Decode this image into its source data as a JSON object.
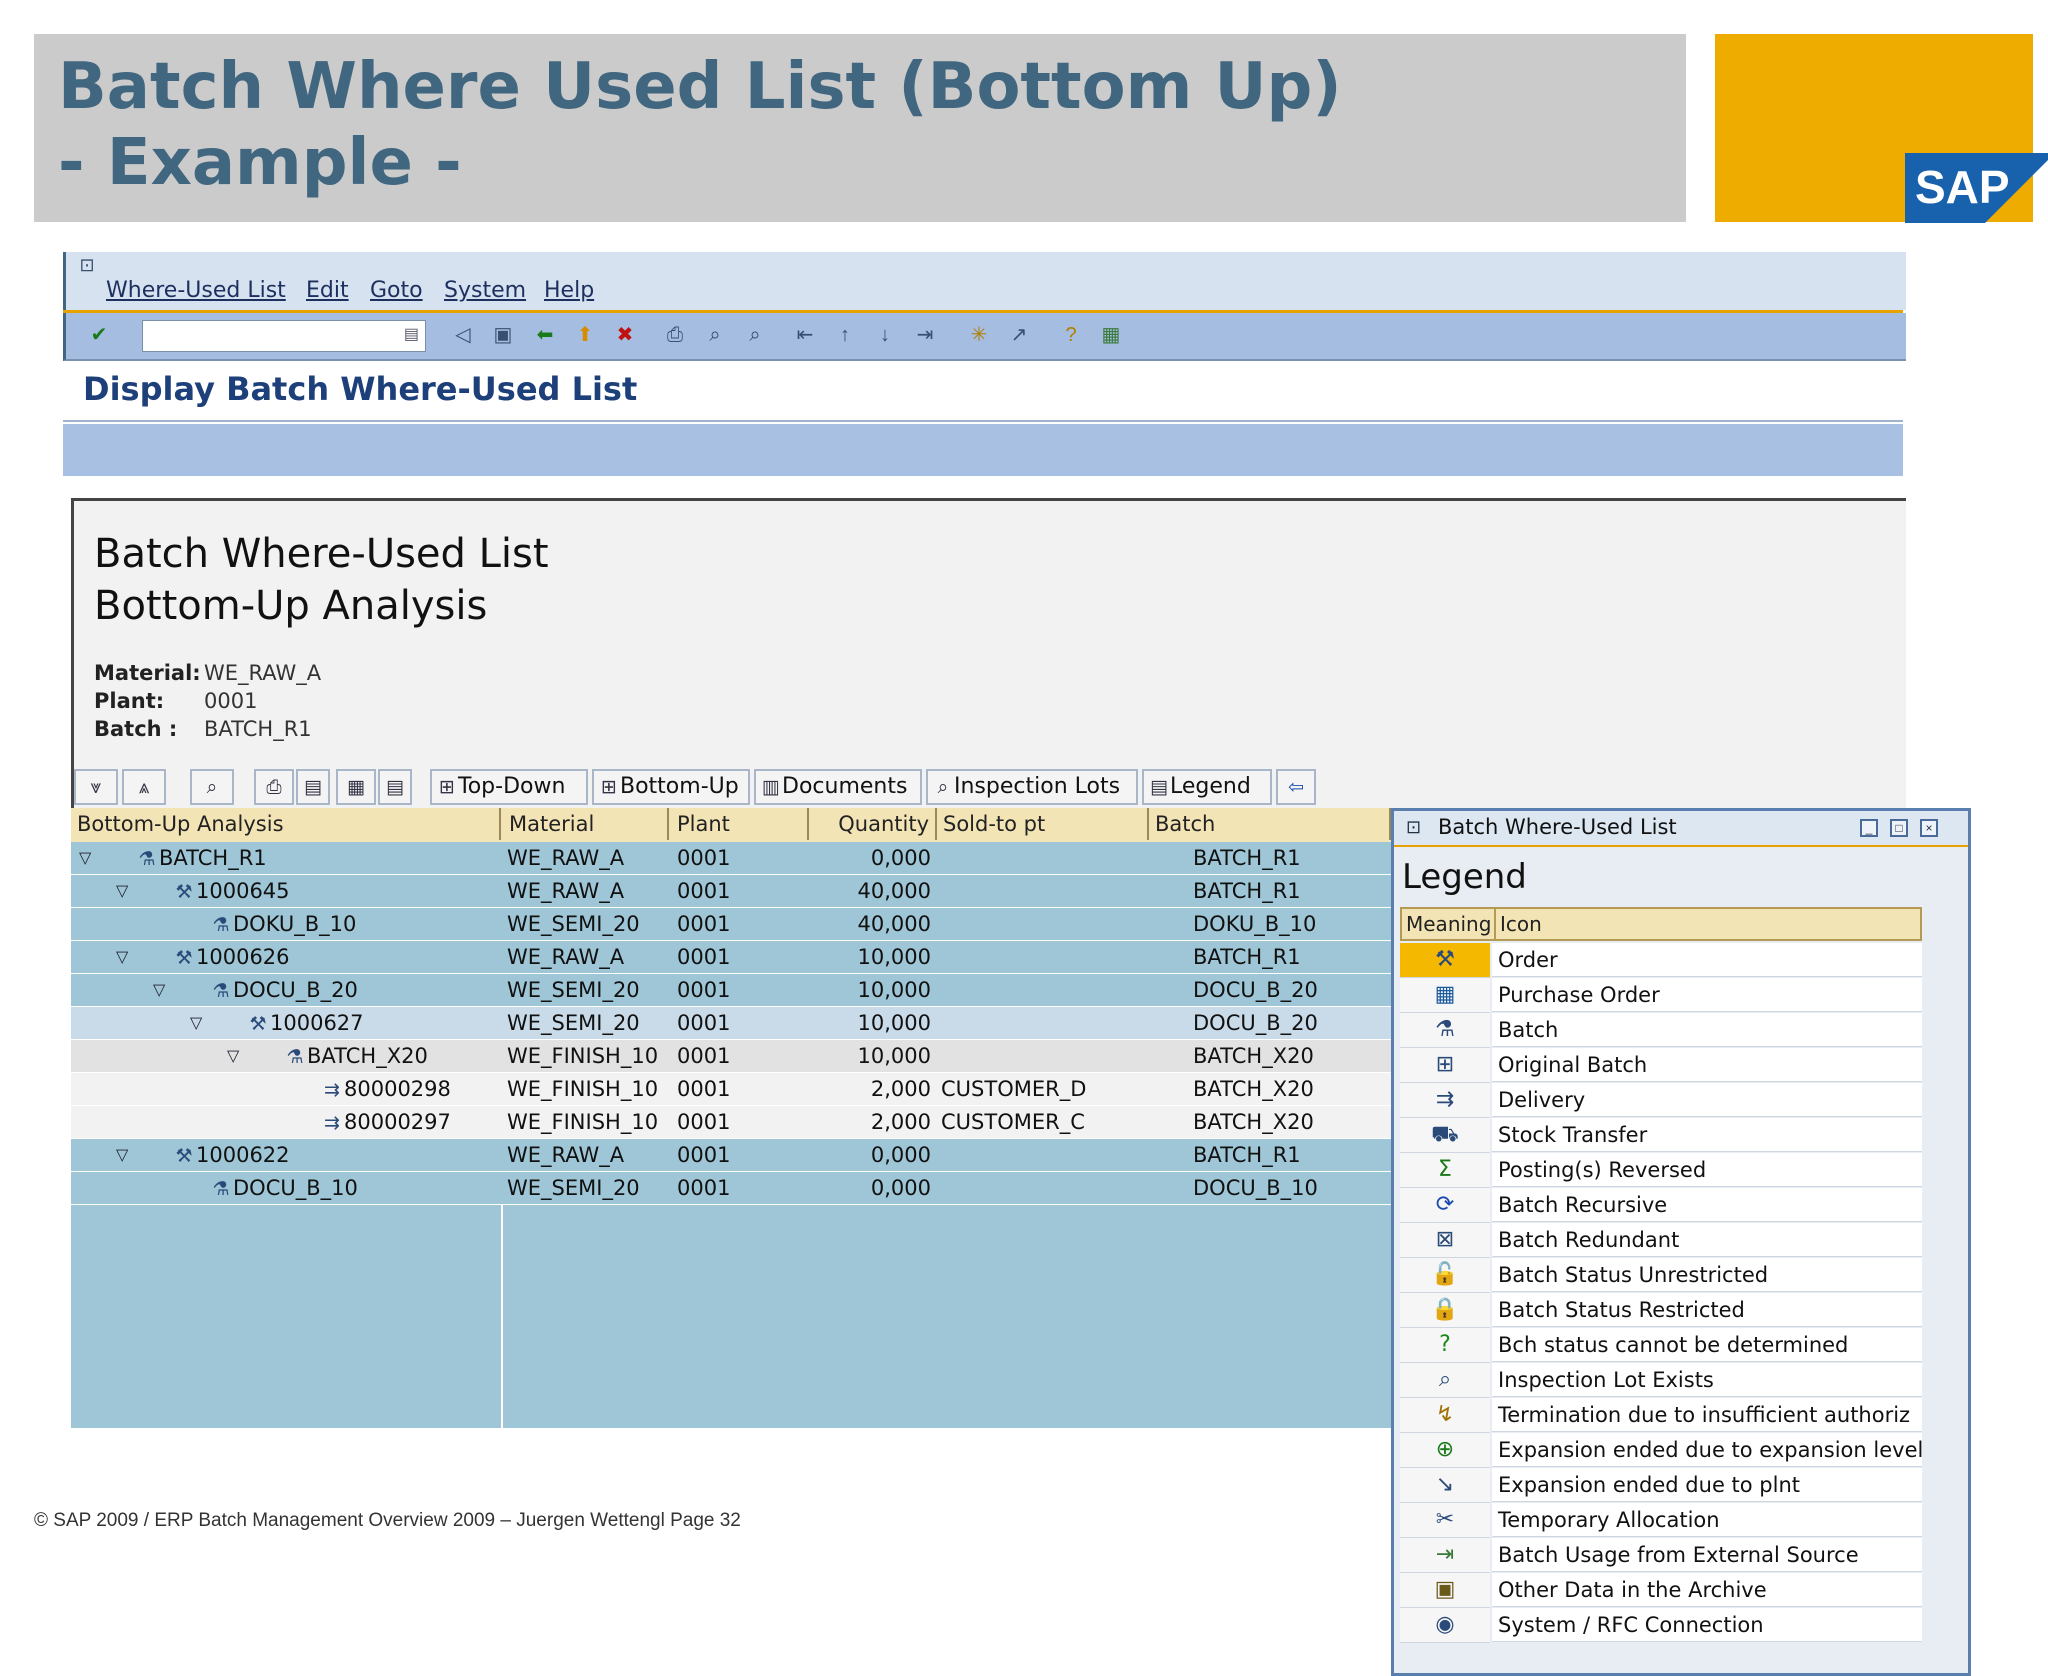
{
  "slide": {
    "title_line1": "Batch Where Used List (Bottom Up)",
    "title_line2": "- Example -",
    "logo_text": "SAP",
    "footer": "© SAP 2009 / ERP Batch Management Overview  2009 – Juergen Wettengl Page 32",
    "colors": {
      "title_bg": "#cbcbcb",
      "title_text": "#41667f",
      "logo_bg": "#eeac00",
      "logo_blue": "#1861ac"
    }
  },
  "menu": [
    "Where-Used List",
    "Edit",
    "Goto",
    "System",
    "Help"
  ],
  "toolbar_icons": [
    "enter-icon",
    "command-field",
    "save-icon",
    "back-icon",
    "exit-icon",
    "cancel-icon",
    "print-icon",
    "find-icon",
    "find-next-icon",
    "first-page-icon",
    "previous-page-icon",
    "next-page-icon",
    "last-page-icon",
    "new-session-icon",
    "shortcut-icon",
    "help-icon",
    "layout-icon"
  ],
  "screen_title": "Display Batch Where-Used List",
  "report": {
    "title_line1": "Batch Where-Used List",
    "title_line2": "Bottom-Up Analysis",
    "fields": [
      {
        "label": "Material:",
        "value": "WE_RAW_A"
      },
      {
        "label": "Plant:",
        "value": "0001"
      },
      {
        "label": "Batch :",
        "value": "BATCH_R1"
      }
    ]
  },
  "alv_buttons": [
    "Top-Down",
    "Bottom-Up",
    "Documents",
    "Inspection Lots",
    "Legend"
  ],
  "grid": {
    "columns": [
      "Bottom-Up Analysis",
      "Material",
      "Plant",
      "Quantity",
      "Sold-to pt",
      "Batch"
    ],
    "rows": [
      {
        "level": 0,
        "expand": true,
        "icon": "batch-icon",
        "node": "BATCH_R1",
        "material": "WE_RAW_A",
        "plant": "0001",
        "quantity": "0,000",
        "sold_to": "",
        "batch": "BATCH_R1"
      },
      {
        "level": 1,
        "expand": true,
        "icon": "order-icon",
        "node": "1000645",
        "material": "WE_RAW_A",
        "plant": "0001",
        "quantity": "40,000",
        "sold_to": "",
        "batch": "BATCH_R1"
      },
      {
        "level": 2,
        "expand": false,
        "icon": "batch-icon",
        "node": "DOKU_B_10",
        "material": "WE_SEMI_20",
        "plant": "0001",
        "quantity": "40,000",
        "sold_to": "",
        "batch": "DOKU_B_10"
      },
      {
        "level": 1,
        "expand": true,
        "icon": "order-icon",
        "node": "1000626",
        "material": "WE_RAW_A",
        "plant": "0001",
        "quantity": "10,000",
        "sold_to": "",
        "batch": "BATCH_R1"
      },
      {
        "level": 2,
        "expand": true,
        "icon": "batch-icon",
        "node": "DOCU_B_20",
        "material": "WE_SEMI_20",
        "plant": "0001",
        "quantity": "10,000",
        "sold_to": "",
        "batch": "DOCU_B_20"
      },
      {
        "level": 3,
        "expand": true,
        "icon": "order-icon",
        "node": "1000627",
        "material": "WE_SEMI_20",
        "plant": "0001",
        "quantity": "10,000",
        "sold_to": "",
        "batch": "DOCU_B_20"
      },
      {
        "level": 4,
        "expand": true,
        "icon": "batch-icon",
        "node": "BATCH_X20",
        "material": "WE_FINISH_10",
        "plant": "0001",
        "quantity": "10,000",
        "sold_to": "",
        "batch": "BATCH_X20"
      },
      {
        "level": 5,
        "expand": false,
        "icon": "delivery-icon",
        "node": "80000298",
        "material": "WE_FINISH_10",
        "plant": "0001",
        "quantity": "2,000",
        "sold_to": "CUSTOMER_D",
        "batch": "BATCH_X20"
      },
      {
        "level": 5,
        "expand": false,
        "icon": "delivery-icon",
        "node": "80000297",
        "material": "WE_FINISH_10",
        "plant": "0001",
        "quantity": "2,000",
        "sold_to": "CUSTOMER_C",
        "batch": "BATCH_X20"
      },
      {
        "level": 1,
        "expand": true,
        "icon": "order-icon",
        "node": "1000622",
        "material": "WE_RAW_A",
        "plant": "0001",
        "quantity": "0,000",
        "sold_to": "",
        "batch": "BATCH_R1"
      },
      {
        "level": 2,
        "expand": false,
        "icon": "batch-icon",
        "node": "DOCU_B_10",
        "material": "WE_SEMI_20",
        "plant": "0001",
        "quantity": "0,000",
        "sold_to": "",
        "batch": "DOCU_B_10"
      }
    ]
  },
  "legend_window": {
    "title": "Batch Where-Used List",
    "heading": "Legend",
    "col_meaning": "Meaning",
    "col_icon": "Icon",
    "entries": [
      {
        "icon": "order-icon",
        "text": "Order"
      },
      {
        "icon": "purchase-order-icon",
        "text": "Purchase Order"
      },
      {
        "icon": "batch-icon",
        "text": "Batch"
      },
      {
        "icon": "original-batch-icon",
        "text": "Original Batch"
      },
      {
        "icon": "delivery-icon",
        "text": "Delivery"
      },
      {
        "icon": "stock-transfer-icon",
        "text": "Stock Transfer"
      },
      {
        "icon": "posting-reversed-icon",
        "text": "Posting(s) Reversed"
      },
      {
        "icon": "batch-recursive-icon",
        "text": "Batch Recursive"
      },
      {
        "icon": "batch-redundant-icon",
        "text": "Batch Redundant"
      },
      {
        "icon": "unlocked-icon",
        "text": "Batch Status Unrestricted"
      },
      {
        "icon": "locked-icon",
        "text": "Batch Status Restricted"
      },
      {
        "icon": "question-icon",
        "text": "Bch status cannot be determined"
      },
      {
        "icon": "inspection-lot-icon",
        "text": "Inspection Lot Exists"
      },
      {
        "icon": "termination-icon",
        "text": "Termination due to insufficient authoriz"
      },
      {
        "icon": "expansion-level-icon",
        "text": "Expansion ended due to expansion level"
      },
      {
        "icon": "expansion-plant-icon",
        "text": "Expansion ended due to plnt"
      },
      {
        "icon": "temporary-allocation-icon",
        "text": "Temporary Allocation"
      },
      {
        "icon": "external-source-icon",
        "text": "Batch Usage from External Source"
      },
      {
        "icon": "archive-icon",
        "text": "Other Data in the Archive"
      },
      {
        "icon": "rfc-connection-icon",
        "text": "System / RFC Connection"
      }
    ]
  }
}
